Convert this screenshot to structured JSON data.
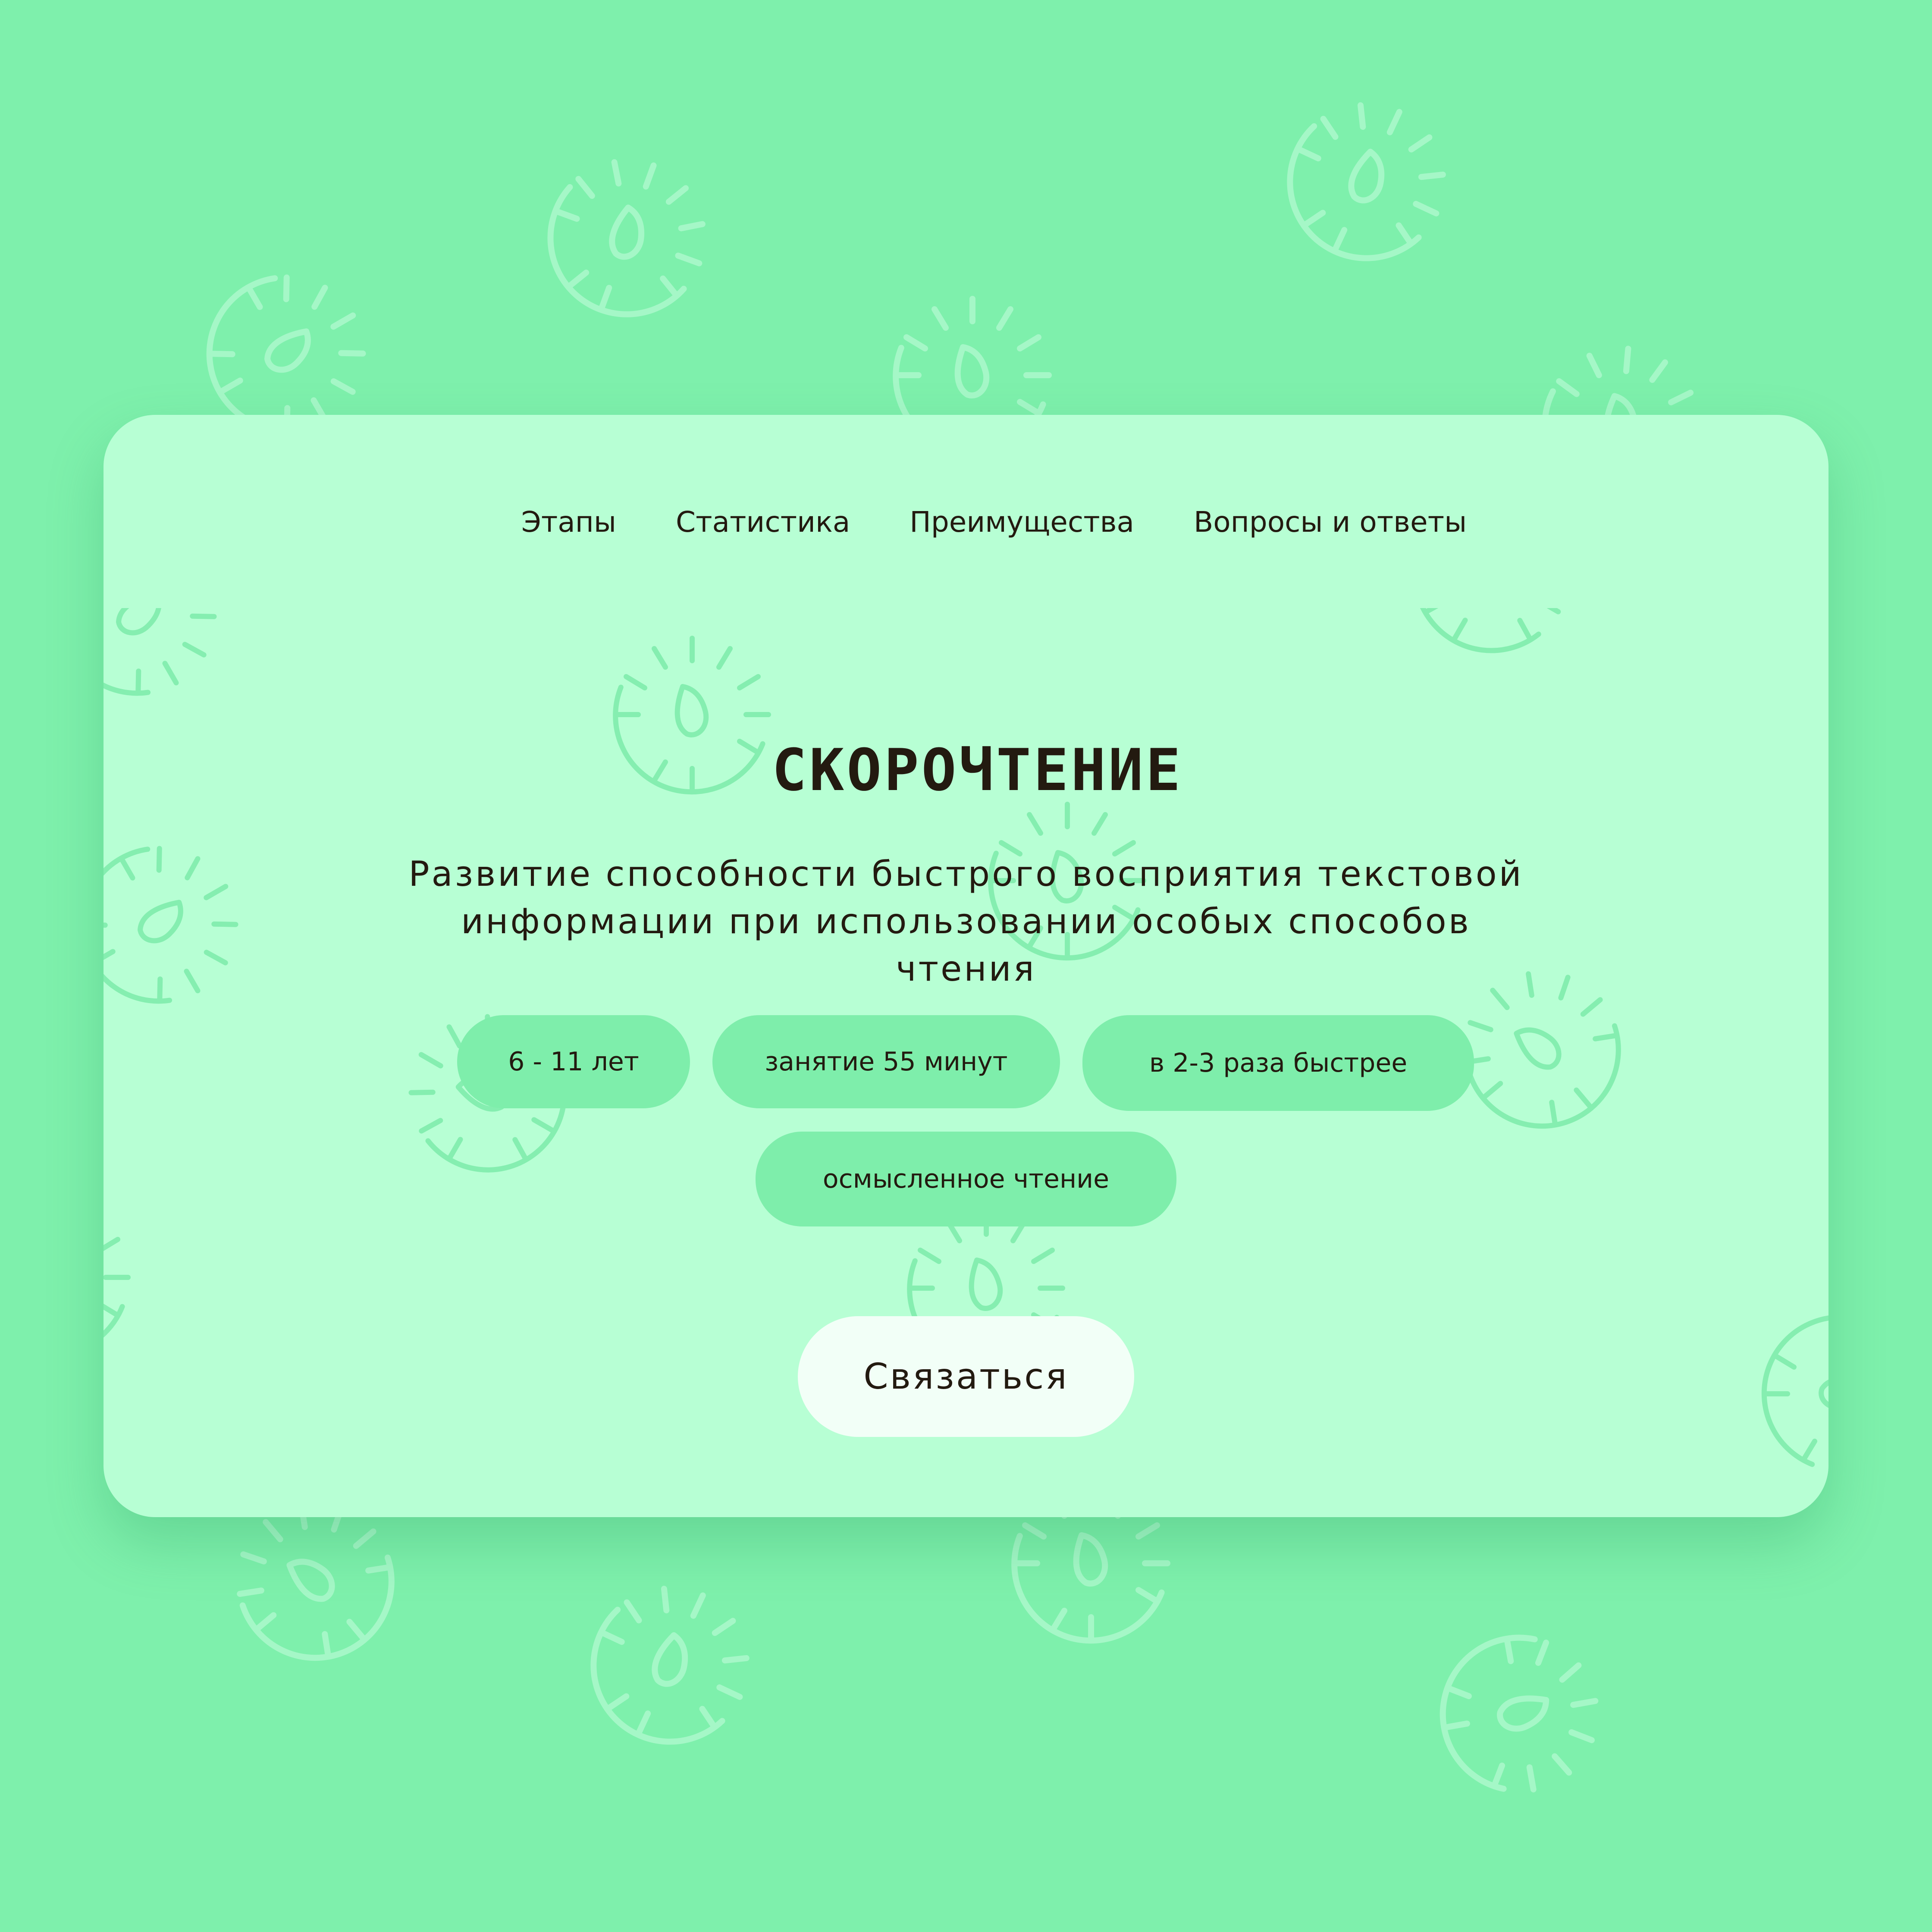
{
  "nav": {
    "items": [
      {
        "label": "Этапы"
      },
      {
        "label": "Статистика"
      },
      {
        "label": "Преимущества"
      },
      {
        "label": "Вопросы и ответы"
      }
    ]
  },
  "hero": {
    "title": "СКОРОЧТЕНИЕ",
    "subtitle": "Развитие способности быстрого восприятия текстовой информации при использовании особых способов чтения"
  },
  "tags": [
    {
      "label": "6 - 11 лет"
    },
    {
      "label": "занятие 55 минут"
    },
    {
      "label": "в 2-3 раза быстрее"
    },
    {
      "label": "осмысленное чтение"
    }
  ],
  "cta": {
    "label": "Связаться"
  },
  "decor": {
    "icon": "stopwatch-icon"
  },
  "colors": {
    "background": "#7ef0ac",
    "card": "#b7ffd4",
    "pill": "#7eeeab",
    "button": "#f2fff7",
    "text": "#231a10"
  }
}
